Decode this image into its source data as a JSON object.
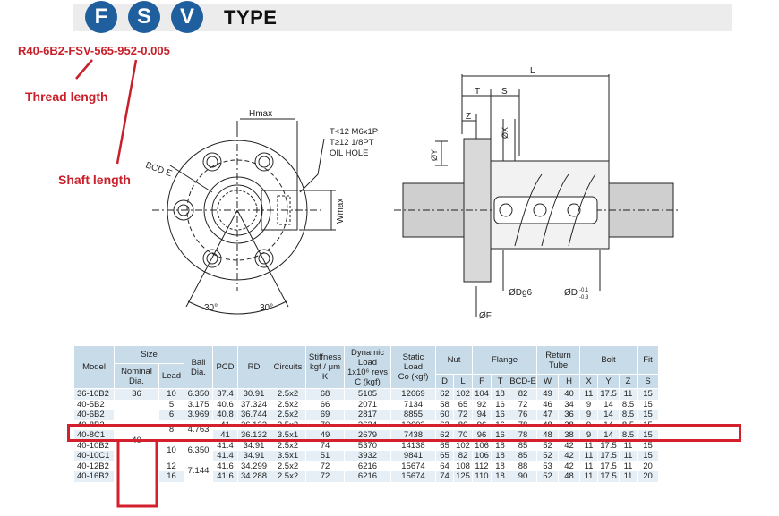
{
  "header": {
    "letters": [
      "F",
      "S",
      "V"
    ],
    "type_label": "TYPE",
    "part_number": "R40-6B2-FSV-565-952-0.005",
    "thread_length_label": "Thread length",
    "shaft_length_label": "Shaft length"
  },
  "drawing": {
    "hmax": "Hmax",
    "bcd": "BCD E",
    "note1": "T<12  M6x1P",
    "note2": "T≥12  1/8PT",
    "note3": "OIL HOLE",
    "wmax": "Wmax",
    "angle1": "30°",
    "angle2": "30°",
    "l": "L",
    "t": "T",
    "s": "S",
    "z": "Z",
    "x": "ØX",
    "y": "ØY",
    "dg6": "ØDg6",
    "d_tol": "ØD",
    "d_tol_sup": "-0.1",
    "d_tol_sub": "-0.3",
    "f": "ØF"
  },
  "table": {
    "headers": {
      "model": "Model",
      "size": "Size",
      "nominal_dia": "Nominal Dia.",
      "lead": "Lead",
      "ball_dia": "Ball Dia.",
      "pcd": "PCD",
      "rd": "RD",
      "circuits": "Circuits",
      "stiffness_1": "Stiffness",
      "stiffness_2": "kgf / μm",
      "stiffness_3": "K",
      "dynamic_1": "Dynamic",
      "dynamic_2": "Load",
      "dynamic_3": "1x10⁶ revs",
      "dynamic_4": "C (kgf)",
      "static_1": "Static",
      "static_2": "Load",
      "static_3": "Co (kgf)",
      "nut": "Nut",
      "flange": "Flange",
      "return_1": "Return",
      "return_2": "Tube",
      "bolt": "Bolt",
      "fit": "Fit",
      "sub_d": "D",
      "sub_l": "L",
      "sub_f": "F",
      "sub_t": "T",
      "sub_bcde": "BCD-E",
      "sub_w": "W",
      "sub_h": "H",
      "sub_x": "X",
      "sub_y": "Y",
      "sub_z": "Z",
      "sub_s": "S"
    },
    "group_nominal_36": "36",
    "group_nominal_40": "40",
    "rows": [
      [
        "36-10B2",
        "",
        "10",
        "6.350",
        "37.4",
        "30.91",
        "2.5x2",
        "68",
        "5105",
        "12669",
        "62",
        "102",
        "104",
        "18",
        "82",
        "49",
        "40",
        "11",
        "17.5",
        "11",
        "15"
      ],
      [
        "40-5B2",
        "",
        "5",
        "3.175",
        "40.6",
        "37.324",
        "2.5x2",
        "66",
        "2071",
        "7134",
        "58",
        "65",
        "92",
        "16",
        "72",
        "46",
        "34",
        "9",
        "14",
        "8.5",
        "15"
      ],
      [
        "40-6B2",
        "",
        "6",
        "3.969",
        "40.8",
        "36.744",
        "2.5x2",
        "69",
        "2817",
        "8855",
        "60",
        "72",
        "94",
        "16",
        "76",
        "47",
        "36",
        "9",
        "14",
        "8.5",
        "15"
      ],
      [
        "40-8B2",
        "",
        "8",
        "4.763",
        "41",
        "36.132",
        "2.5x2",
        "70",
        "3634",
        "10603",
        "62",
        "86",
        "96",
        "16",
        "78",
        "48",
        "38",
        "9",
        "14",
        "8.5",
        "15"
      ],
      [
        "40-8C1",
        "",
        "",
        "",
        "41",
        "36.132",
        "3.5x1",
        "49",
        "2679",
        "7438",
        "62",
        "70",
        "96",
        "16",
        "78",
        "48",
        "38",
        "9",
        "14",
        "8.5",
        "15"
      ],
      [
        "40-10B2",
        "",
        "10",
        "6.350",
        "41.4",
        "34.91",
        "2.5x2",
        "74",
        "5370",
        "14138",
        "65",
        "102",
        "106",
        "18",
        "85",
        "52",
        "42",
        "11",
        "17.5",
        "11",
        "15"
      ],
      [
        "40-10C1",
        "",
        "",
        "",
        "41.4",
        "34.91",
        "3.5x1",
        "51",
        "3932",
        "9841",
        "65",
        "82",
        "106",
        "18",
        "85",
        "52",
        "42",
        "11",
        "17.5",
        "11",
        "15"
      ],
      [
        "40-12B2",
        "",
        "12",
        "7.144",
        "41.6",
        "34.299",
        "2.5x2",
        "72",
        "6216",
        "15674",
        "64",
        "108",
        "112",
        "18",
        "88",
        "53",
        "42",
        "11",
        "17.5",
        "11",
        "20"
      ],
      [
        "40-16B2",
        "",
        "16",
        "",
        "41.6",
        "34.288",
        "2.5x2",
        "72",
        "6216",
        "15674",
        "74",
        "125",
        "110",
        "18",
        "90",
        "52",
        "48",
        "11",
        "17.5",
        "11",
        "20"
      ]
    ]
  }
}
